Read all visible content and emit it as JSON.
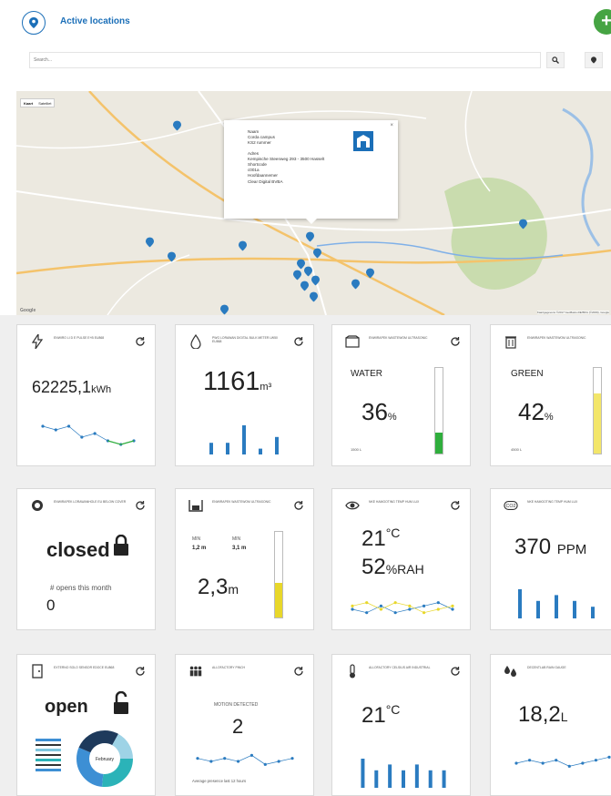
{
  "header": {
    "title": "Active locations",
    "add_label": "+"
  },
  "search": {
    "placeholder": "Search..."
  },
  "map": {
    "toggle_map": "Kaart",
    "toggle_sat": "Satelliet",
    "attribution": "Kaartgegevens ©2017 GeoBasis-DE/BKG (©2009), Google",
    "google_label": "Google",
    "popup": {
      "name_label": "Naam",
      "name_1": "Corda campus",
      "name_2": "KS2 rummer",
      "addr_label": "Adres",
      "addr": "Kempische Steenweg 293 - 3500 Hasselt",
      "short_label": "Shortcode",
      "short": "c001a",
      "owner_label": "Hoofdaannemer",
      "owner": "Clear Digital BVBA",
      "close": "×"
    }
  },
  "cards": [
    {
      "title": "ENWIRO LI D E PULSE E+B EU868",
      "value": "62225,1",
      "unit": "kWh",
      "spark": [
        6,
        5,
        6,
        3,
        4,
        2,
        1,
        2
      ]
    },
    {
      "title": "PWG LORAWAN DIGITAL BULK METER LW50 EU868",
      "value": "1161",
      "unit": "m³",
      "bars": [
        2,
        2,
        5,
        1,
        3
      ]
    },
    {
      "title": "ENWIRAPEK WASTEWOM ULTRASONIC",
      "label": "WATER",
      "value": "36",
      "unit": "%",
      "capacity": "1500 L",
      "level": 0.24,
      "fill_color": "#2fae3c"
    },
    {
      "title": "ENWIRAPEK WASTEWOM ULTRASONIC",
      "label": "GREEN",
      "value": "42",
      "unit": "%",
      "capacity": "4500 L",
      "level": 0.7,
      "fill_color": "#f3e66a"
    },
    {
      "title": "ENWIRAPEK LORAWANHOLE EU BELOW COVER",
      "value": "closed",
      "sub_label": "# opens this month",
      "sub_value": "0"
    },
    {
      "title": "ENWIRAPEK WASTEWOM ULTRASONIC",
      "min_label": "MIN",
      "min_value": "1,2 m",
      "max_label": "MIN",
      "max_value": "3,1 m",
      "value": "2,3",
      "unit": "m",
      "level": 0.4,
      "fill_color": "#e8d72a"
    },
    {
      "title": "NKE HAMOOTING TEMP HUM LUX",
      "value": "21",
      "unit": "°C",
      "value2": "52",
      "unit2": "%RAH",
      "spark": [
        3,
        2,
        4,
        2,
        3,
        4,
        5,
        3
      ],
      "spark2": [
        4,
        5,
        3,
        5,
        4,
        2,
        3,
        4
      ]
    },
    {
      "title": "NKE HAMOOTING TEMP HUM LUX",
      "value": "370",
      "unit": "PPM",
      "bars": [
        5,
        3,
        4,
        3,
        2
      ]
    },
    {
      "title": "EXTERNO SOLO SENSOR EDOCE EU868",
      "value": "open",
      "donut_label": "February"
    },
    {
      "title": "ALLOFACTORY PINCH",
      "sub_label": "MOTION DETECTED",
      "value": "2",
      "footer": "Average presence last 12 hours",
      "spark": [
        4,
        3,
        4,
        3,
        5,
        2,
        3,
        4
      ]
    },
    {
      "title": "ALLOFACTORY CELSIUS AIR INDUSTRIAL",
      "value": "21",
      "unit": "°C",
      "bars": [
        5,
        3,
        4,
        3,
        4,
        3,
        3
      ]
    },
    {
      "title": "DECENTLAB RAIN GAUGE",
      "value": "18,2",
      "unit": "L",
      "spark": [
        3,
        4,
        3,
        4,
        2,
        3,
        4,
        5
      ]
    }
  ],
  "colors": {
    "accent": "#1b6fb8",
    "add": "#46a443",
    "spark_blue": "#2a7bc0",
    "spark_green": "#2fae3c",
    "spark_yellow": "#e8d72a"
  }
}
